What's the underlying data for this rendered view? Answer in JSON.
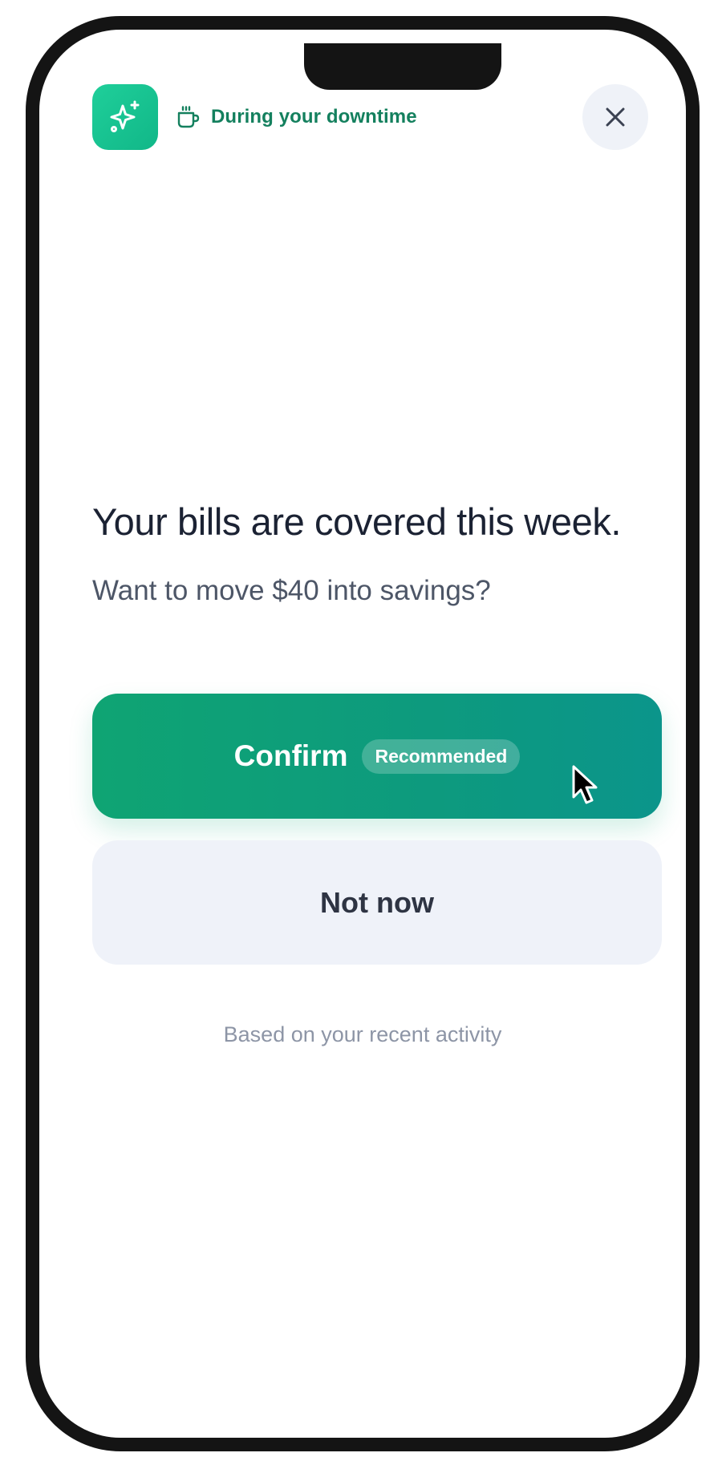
{
  "header": {
    "context_label": "During your downtime",
    "app_icon": "sparkles-icon",
    "context_icon": "coffee-cup-icon",
    "close_icon": "close-icon"
  },
  "message": {
    "headline": "Your bills are covered this week.",
    "subtext": "Want to move $40 into savings?"
  },
  "actions": {
    "confirm_label": "Confirm",
    "confirm_badge": "Recommended",
    "dismiss_label": "Not now"
  },
  "footnote": "Based on your recent activity",
  "colors": {
    "accent": "#11b788",
    "accent_dark": "#0d9a7e",
    "context_text": "#14805e",
    "secondary_button": "#eff2f9"
  }
}
